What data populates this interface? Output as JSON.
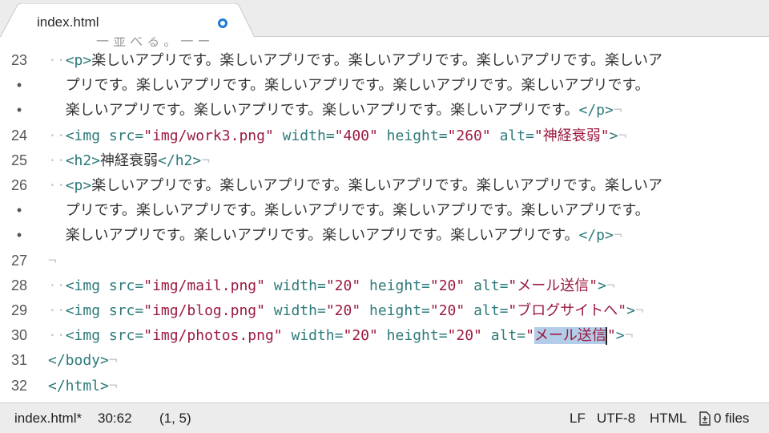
{
  "tab": {
    "title": "index.html"
  },
  "editor": {
    "partial_top_text": "一 並 べ る 。 一 ー",
    "lines": [
      {
        "gutter": "23",
        "segments": [
          {
            "t": "··",
            "c": "inv"
          },
          {
            "t": "<p>",
            "c": "tag"
          },
          {
            "t": "楽しいアプリです。楽しいアプリです。楽しいアプリです。楽しいアプリです。楽しいア",
            "c": "txt"
          }
        ]
      },
      {
        "gutter": "•",
        "segments": [
          {
            "t": "  ",
            "c": "inv"
          },
          {
            "t": "プリです。楽しいアプリです。楽しいアプリです。楽しいアプリです。楽しいアプリです。",
            "c": "txt"
          }
        ]
      },
      {
        "gutter": "•",
        "segments": [
          {
            "t": "  ",
            "c": "inv"
          },
          {
            "t": "楽しいアプリです。楽しいアプリです。楽しいアプリです。楽しいアプリです。",
            "c": "txt"
          },
          {
            "t": "</p>",
            "c": "tag"
          },
          {
            "t": "¬",
            "c": "inv"
          }
        ]
      },
      {
        "gutter": "24",
        "segments": [
          {
            "t": "··",
            "c": "inv"
          },
          {
            "t": "<img ",
            "c": "tag"
          },
          {
            "t": "src=",
            "c": "attr"
          },
          {
            "t": "\"img/work3.png\"",
            "c": "str"
          },
          {
            "t": " width=",
            "c": "attr"
          },
          {
            "t": "\"400\"",
            "c": "str"
          },
          {
            "t": " height=",
            "c": "attr"
          },
          {
            "t": "\"260\"",
            "c": "str"
          },
          {
            "t": " alt=",
            "c": "attr"
          },
          {
            "t": "\"神経衰弱\"",
            "c": "str"
          },
          {
            "t": ">",
            "c": "tag"
          },
          {
            "t": "¬",
            "c": "inv"
          }
        ]
      },
      {
        "gutter": "25",
        "segments": [
          {
            "t": "··",
            "c": "inv"
          },
          {
            "t": "<h2>",
            "c": "tag"
          },
          {
            "t": "神経衰弱",
            "c": "txt"
          },
          {
            "t": "</h2>",
            "c": "tag"
          },
          {
            "t": "¬",
            "c": "inv"
          }
        ]
      },
      {
        "gutter": "26",
        "segments": [
          {
            "t": "··",
            "c": "inv"
          },
          {
            "t": "<p>",
            "c": "tag"
          },
          {
            "t": "楽しいアプリです。楽しいアプリです。楽しいアプリです。楽しいアプリです。楽しいア",
            "c": "txt"
          }
        ]
      },
      {
        "gutter": "•",
        "segments": [
          {
            "t": "  ",
            "c": "inv"
          },
          {
            "t": "プリです。楽しいアプリです。楽しいアプリです。楽しいアプリです。楽しいアプリです。",
            "c": "txt"
          }
        ]
      },
      {
        "gutter": "•",
        "segments": [
          {
            "t": "  ",
            "c": "inv"
          },
          {
            "t": "楽しいアプリです。楽しいアプリです。楽しいアプリです。楽しいアプリです。",
            "c": "txt"
          },
          {
            "t": "</p>",
            "c": "tag"
          },
          {
            "t": "¬",
            "c": "inv"
          }
        ]
      },
      {
        "gutter": "27",
        "segments": [
          {
            "t": "¬",
            "c": "inv"
          }
        ]
      },
      {
        "gutter": "28",
        "segments": [
          {
            "t": "··",
            "c": "inv"
          },
          {
            "t": "<img ",
            "c": "tag"
          },
          {
            "t": "src=",
            "c": "attr"
          },
          {
            "t": "\"img/mail.png\"",
            "c": "str"
          },
          {
            "t": " width=",
            "c": "attr"
          },
          {
            "t": "\"20\"",
            "c": "str"
          },
          {
            "t": " height=",
            "c": "attr"
          },
          {
            "t": "\"20\"",
            "c": "str"
          },
          {
            "t": " alt=",
            "c": "attr"
          },
          {
            "t": "\"メール送信\"",
            "c": "str"
          },
          {
            "t": ">",
            "c": "tag"
          },
          {
            "t": "¬",
            "c": "inv"
          }
        ]
      },
      {
        "gutter": "29",
        "segments": [
          {
            "t": "··",
            "c": "inv"
          },
          {
            "t": "<img ",
            "c": "tag"
          },
          {
            "t": "src=",
            "c": "attr"
          },
          {
            "t": "\"img/blog.png\"",
            "c": "str"
          },
          {
            "t": " width=",
            "c": "attr"
          },
          {
            "t": "\"20\"",
            "c": "str"
          },
          {
            "t": " height=",
            "c": "attr"
          },
          {
            "t": "\"20\"",
            "c": "str"
          },
          {
            "t": " alt=",
            "c": "attr"
          },
          {
            "t": "\"ブログサイトへ\"",
            "c": "str"
          },
          {
            "t": ">",
            "c": "tag"
          },
          {
            "t": "¬",
            "c": "inv"
          }
        ]
      },
      {
        "gutter": "30",
        "segments": [
          {
            "t": "··",
            "c": "inv"
          },
          {
            "t": "<img ",
            "c": "tag"
          },
          {
            "t": "src=",
            "c": "attr"
          },
          {
            "t": "\"img/photos.png\"",
            "c": "str"
          },
          {
            "t": " width=",
            "c": "attr"
          },
          {
            "t": "\"20\"",
            "c": "str"
          },
          {
            "t": " height=",
            "c": "attr"
          },
          {
            "t": "\"20\"",
            "c": "str"
          },
          {
            "t": " alt=",
            "c": "attr"
          },
          {
            "t": "\"",
            "c": "str"
          },
          {
            "t": "メール送信",
            "c": "str sel"
          },
          {
            "t": "CURSOR",
            "c": "cursor"
          },
          {
            "t": "\"",
            "c": "str"
          },
          {
            "t": ">",
            "c": "tag"
          },
          {
            "t": "¬",
            "c": "inv"
          }
        ]
      },
      {
        "gutter": "31",
        "segments": [
          {
            "t": "</body>",
            "c": "tag"
          },
          {
            "t": "¬",
            "c": "inv"
          }
        ]
      },
      {
        "gutter": "32",
        "segments": [
          {
            "t": "</html>",
            "c": "tag"
          },
          {
            "t": "¬",
            "c": "inv"
          }
        ]
      }
    ]
  },
  "statusbar": {
    "file": "index.html*",
    "cursor_pos": "30:62",
    "selection": "(1, 5)",
    "line_ending": "LF",
    "encoding": "UTF-8",
    "grammar": "HTML",
    "files": "0 files"
  }
}
